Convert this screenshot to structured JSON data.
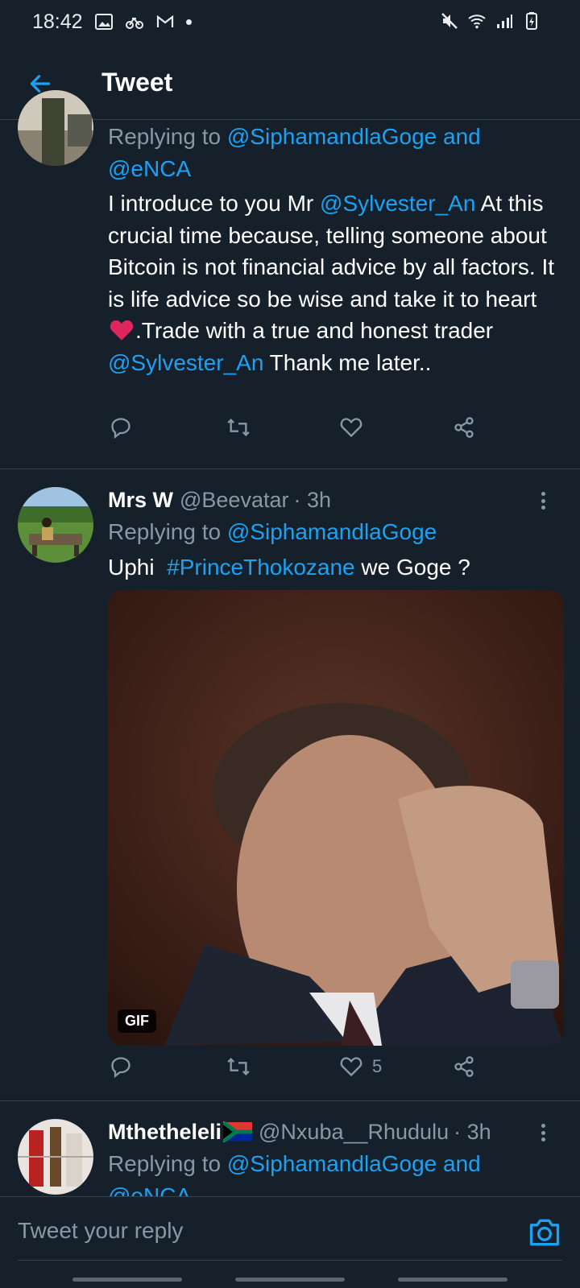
{
  "status_bar": {
    "time": "18:42"
  },
  "header": {
    "title": "Tweet"
  },
  "tweet1": {
    "replying_prefix": "Replying to",
    "reply_to_1": "@SiphamandlaGoge",
    "reply_and": "and",
    "reply_to_2": "@eNCA",
    "text_1": "I introduce to you Mr ",
    "mention_1": "@Sylvester_An",
    "text_2": " At this crucial time because, telling someone about Bitcoin is not financial advice by all factors. It is life advice so be wise and take it to heart ",
    "text_3": ".Trade with a true and honest trader ",
    "mention_2": "@Sylvester_An",
    "text_4": " Thank me later.."
  },
  "tweet2": {
    "name": "Mrs W",
    "handle": "@Beevatar",
    "time": "· 3h",
    "replying_prefix": "Replying to",
    "reply_to_1": "@SiphamandlaGoge",
    "text_1": "Uphi  ",
    "hashtag": "#PrinceThokozane",
    "text_2": " we Goge ?",
    "gif_label": "GIF",
    "like_count": "5"
  },
  "tweet3": {
    "name": "Mthetheleli",
    "handle": "@Nxuba__Rhudulu",
    "time": "· 3h",
    "replying_prefix": "Replying to",
    "reply_to_1": "@SiphamandlaGoge",
    "reply_and": "and",
    "reply_to_2": "@eNCA"
  },
  "reply_bar": {
    "placeholder": "Tweet your reply"
  },
  "colors": {
    "background": "#15202b",
    "accent": "#1da1f2",
    "muted": "#8899a6",
    "heart": "#e0245e"
  }
}
